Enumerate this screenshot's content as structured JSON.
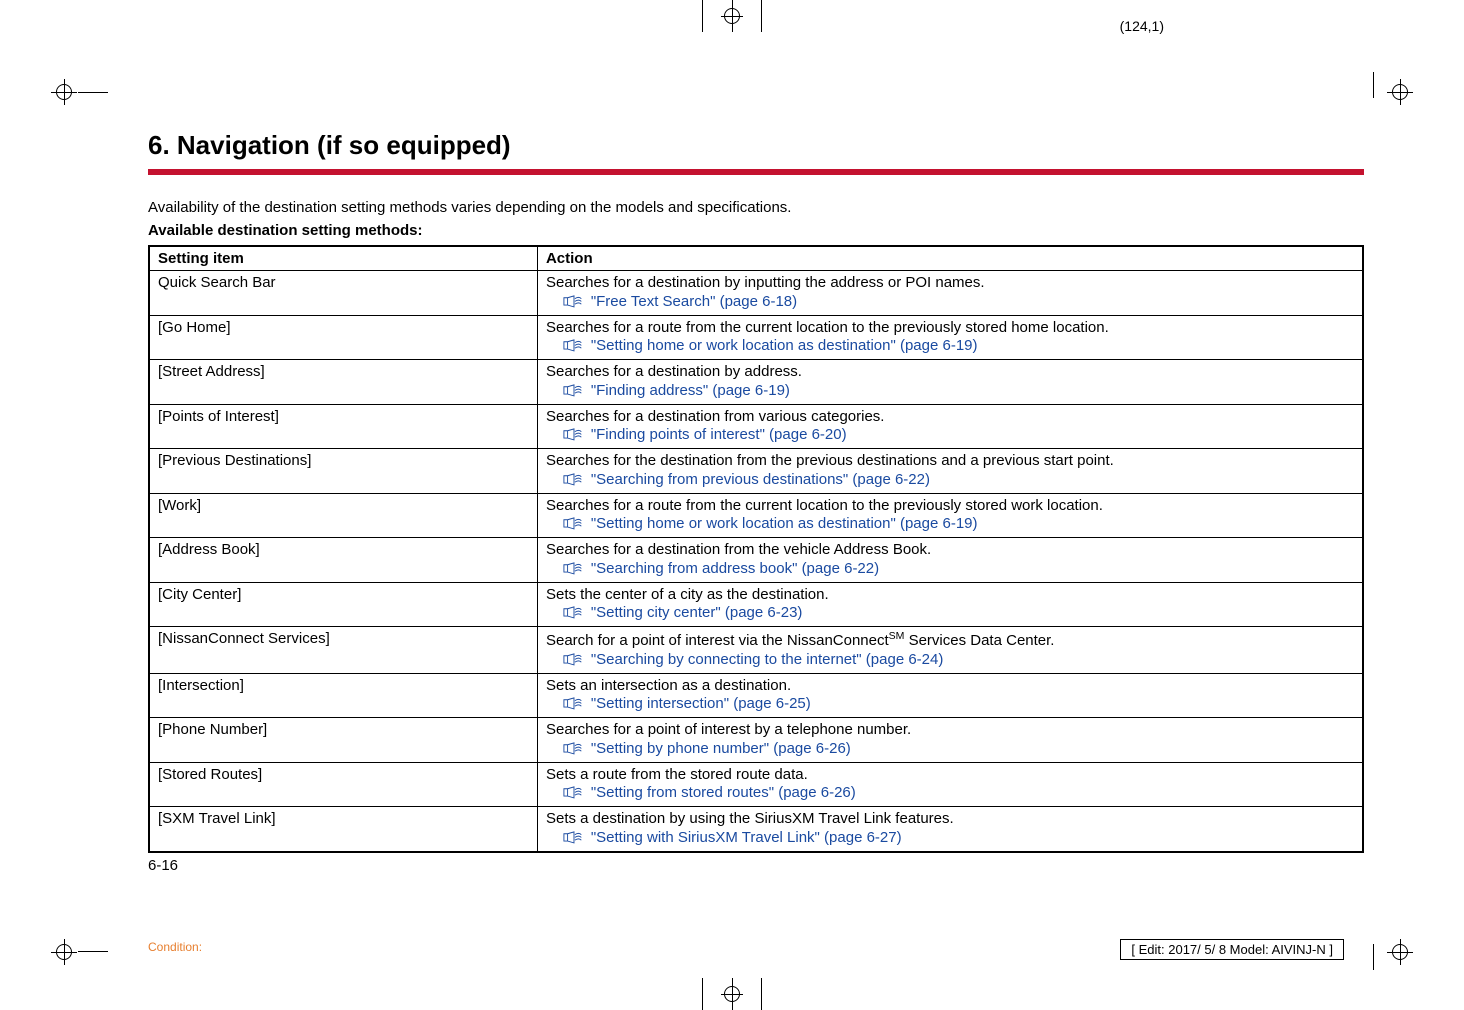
{
  "page_coord": "(124,1)",
  "chapter_title": "6. Navigation (if so equipped)",
  "intro_text": "Availability of the destination setting methods varies depending on the models and specifications.",
  "subheading": "Available destination setting methods:",
  "table": {
    "header_setting": "Setting item",
    "header_action": "Action",
    "rows": [
      {
        "setting": "Quick Search Bar",
        "action": "Searches for a destination by inputting the address or POI names.",
        "xref": "\"Free Text Search\" (page 6-18)"
      },
      {
        "setting": "[Go Home]",
        "action": "Searches for a route from the current location to the previously stored home location.",
        "xref": "\"Setting home or work location as destination\" (page 6-19)"
      },
      {
        "setting": "[Street Address]",
        "action": "Searches for a destination by address.",
        "xref": "\"Finding address\" (page 6-19)"
      },
      {
        "setting": "[Points of Interest]",
        "action": "Searches for a destination from various categories.",
        "xref": "\"Finding points of interest\" (page 6-20)"
      },
      {
        "setting": "[Previous Destinations]",
        "action": "Searches for the destination from the previous destinations and a previous start point.",
        "xref": "\"Searching from previous destinations\" (page 6-22)"
      },
      {
        "setting": "[Work]",
        "action": "Searches for a route from the current location to the previously stored work location.",
        "xref": "\"Setting home or work location as destination\" (page 6-19)"
      },
      {
        "setting": "[Address Book]",
        "action": "Searches for a destination from the vehicle Address Book.",
        "xref": "\"Searching from address book\" (page 6-22)"
      },
      {
        "setting": "[City Center]",
        "action": "Sets the center of a city as the destination.",
        "xref": "\"Setting city center\" (page 6-23)"
      },
      {
        "setting": "[NissanConnect Services]",
        "action_pre": "Search for a point of interest via the NissanConnect",
        "action_sup": "SM",
        "action_post": " Services Data Center.",
        "xref": "\"Searching by connecting to the internet\" (page 6-24)"
      },
      {
        "setting": "[Intersection]",
        "action": "Sets an intersection as a destination.",
        "xref": "\"Setting intersection\" (page 6-25)"
      },
      {
        "setting": "[Phone Number]",
        "action": "Searches for a point of interest by a telephone number.",
        "xref": "\"Setting by phone number\" (page 6-26)"
      },
      {
        "setting": "[Stored Routes]",
        "action": "Sets a route from the stored route data.",
        "xref": "\"Setting from stored routes\" (page 6-26)"
      },
      {
        "setting": "[SXM Travel Link]",
        "action": "Sets a destination by using the SiriusXM Travel Link features.",
        "xref": "\"Setting with SiriusXM Travel Link\" (page 6-27)"
      }
    ]
  },
  "page_number": "6-16",
  "condition_label": "Condition:",
  "edit_info": "[ Edit: 2017/ 5/ 8   Model: AIVINJ-N ]"
}
